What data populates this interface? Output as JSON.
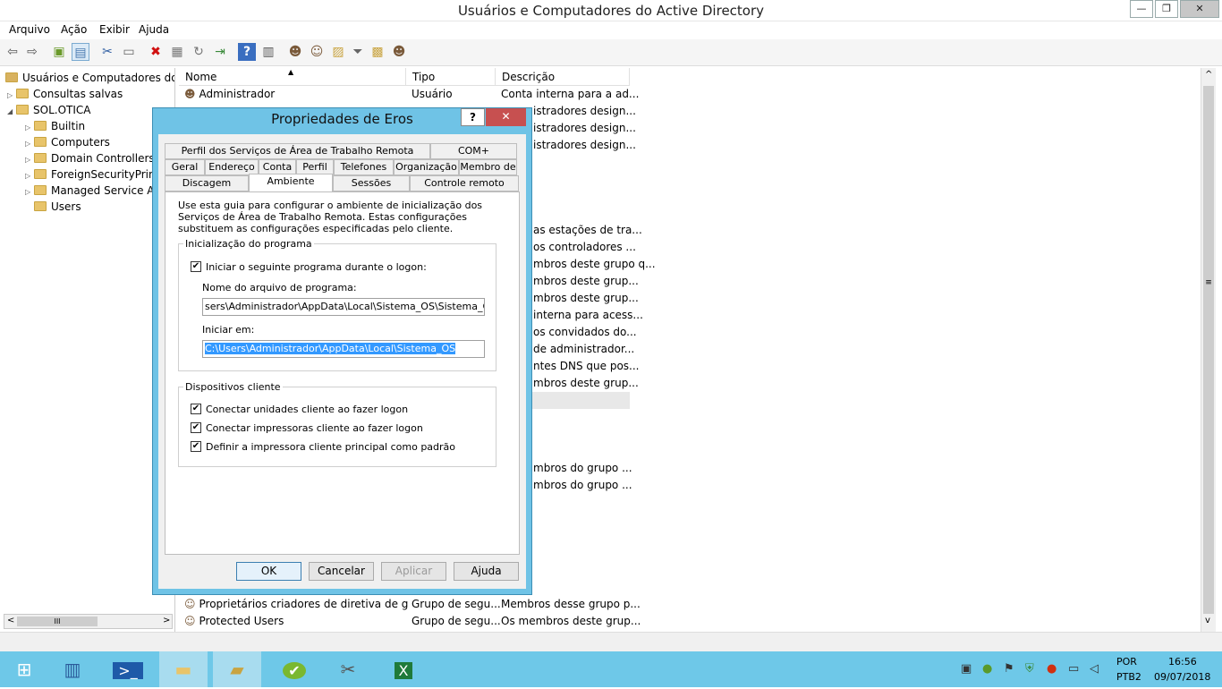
{
  "window": {
    "title": "Usuários e Computadores do Active Directory",
    "controls": {
      "minimize": "—",
      "maximize": "❐",
      "close": "✕"
    }
  },
  "menu": [
    "Arquivo",
    "Ação",
    "Exibir",
    "Ajuda"
  ],
  "toolbar_icons": [
    "back-icon",
    "forward-icon",
    "up-icon",
    "view-icon",
    "cut-icon",
    "clipboard-icon",
    "delete-icon",
    "properties-icon",
    "refresh-icon",
    "export-icon",
    "help-icon",
    "details-icon",
    "user-icon",
    "group-icon",
    "ou-icon",
    "filter-icon",
    "find-icon",
    "add-to-group-icon"
  ],
  "tree": {
    "root": "Usuários e Computadores do Ac",
    "items": [
      {
        "label": "Consultas salvas",
        "level": 1,
        "expander": "▷"
      },
      {
        "label": "SOL.OTICA",
        "level": 1,
        "expander": "◢"
      },
      {
        "label": "Builtin",
        "level": 2,
        "expander": "▷"
      },
      {
        "label": "Computers",
        "level": 2,
        "expander": "▷"
      },
      {
        "label": "Domain Controllers",
        "level": 2,
        "expander": "▷"
      },
      {
        "label": "ForeignSecurityPrinc",
        "level": 2,
        "expander": "▷"
      },
      {
        "label": "Managed Service Ac",
        "level": 2,
        "expander": "▷"
      },
      {
        "label": "Users",
        "level": 2,
        "expander": ""
      }
    ]
  },
  "list": {
    "columns": [
      "Nome",
      "Tipo",
      "Descrição"
    ],
    "sort_indicator": "▲",
    "rows_top": [
      {
        "name": "Administrador",
        "type": "Usuário",
        "desc": "Conta interna para a ad..."
      },
      {
        "desc": "istradores design..."
      },
      {
        "desc": "istradores design..."
      },
      {
        "desc": "istradores design..."
      }
    ],
    "rows_mid": [
      "as estações de tra...",
      "os controladores ...",
      "mbros deste grupo q...",
      "mbros deste grup...",
      "mbros deste grup...",
      "interna para acess...",
      "os convidados do...",
      "de administrador...",
      "ntes DNS que pos...",
      "mbros deste grup..."
    ],
    "rows_lower": [
      "mbros do grupo ...",
      "mbros do grupo ..."
    ],
    "rows_bottom": [
      {
        "name": "Proprietários criadores de diretiva de grupo",
        "type": "Grupo de segu...",
        "desc": "Membros desse grupo p..."
      },
      {
        "name": "Protected Users",
        "type": "Grupo de segu...",
        "desc": "Os membros deste grup..."
      }
    ]
  },
  "dialog": {
    "title": "Propriedades de Eros",
    "help": "?",
    "close": "✕",
    "tabs_row1": [
      "Perfil dos Serviços de Área de Trabalho Remota",
      "COM+"
    ],
    "tabs_row2": [
      "Geral",
      "Endereço",
      "Conta",
      "Perfil",
      "Telefones",
      "Organização",
      "Membro de"
    ],
    "tabs_row3": [
      "Discagem",
      "Ambiente",
      "Sessões",
      "Controle remoto"
    ],
    "intro": "Use esta guia para configurar o ambiente de inicialização dos Serviços de Área de Trabalho Remota. Estas configurações substituem as configurações especificadas pelo cliente.",
    "startup_group": "Inicialização do programa",
    "start_program_label": "Iniciar o seguinte programa durante o logon:",
    "start_program_checked": true,
    "program_file_label": "Nome do arquivo de programa:",
    "program_file_value": "sers\\Administrador\\AppData\\Local\\Sistema_OS\\Sistema_OS.exe",
    "start_in_label": "Iniciar em:",
    "start_in_value": "C:\\Users\\Administrador\\AppData\\Local\\Sistema_OS",
    "devices_group": "Dispositivos cliente",
    "devices": [
      {
        "label": "Conectar unidades cliente ao fazer logon",
        "checked": true
      },
      {
        "label": "Conectar impressoras cliente ao fazer logon",
        "checked": true
      },
      {
        "label": "Definir a impressora cliente principal como padrão",
        "checked": true
      }
    ],
    "check_mark": "✔",
    "buttons": {
      "ok": "OK",
      "cancel": "Cancelar",
      "apply": "Aplicar",
      "help": "Ajuda"
    }
  },
  "scrollbar": {
    "thumb": "III",
    "left": "<",
    "right": ">",
    "up": "^",
    "down": "v",
    "grip": "≡"
  },
  "taskbar": {
    "apps": [
      "windows-logo-icon",
      "server-manager-icon",
      "powershell-icon",
      "file-explorer-icon",
      "ad-users-icon",
      "green-app-icon",
      "tools-icon",
      "excel-icon"
    ],
    "tray": {
      "lang1": "POR",
      "lang2": "PTB2",
      "time": "16:56",
      "date": "09/07/2018"
    }
  }
}
